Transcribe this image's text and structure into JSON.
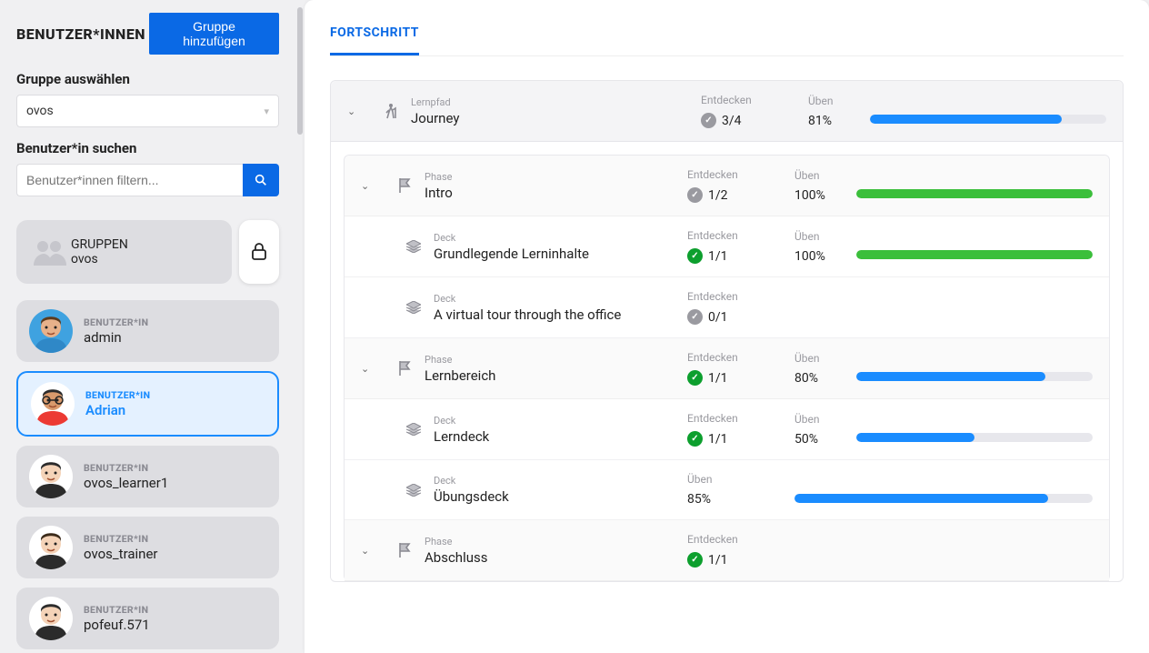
{
  "sidebar": {
    "title": "BENUTZER*INNEN",
    "add_group_btn": "Gruppe hinzufügen",
    "group_select_label": "Gruppe auswählen",
    "group_selected": "ovos",
    "search_label": "Benutzer*in suchen",
    "search_placeholder": "Benutzer*innen filtern...",
    "group_card": {
      "type": "GRUPPEN",
      "name": "ovos"
    },
    "users": [
      {
        "type": "BENUTZER*IN",
        "name": "admin",
        "bg": "#3fa2e0",
        "shirt": "#2f88c7",
        "skin": "#e7b18a",
        "hair": "#5b3a1d"
      },
      {
        "type": "BENUTZER*IN",
        "name": "Adrian",
        "bg": "#fff",
        "shirt": "#ec3a33",
        "skin": "#d99a6c",
        "hair": "#2b2b2b",
        "glasses": true
      },
      {
        "type": "BENUTZER*IN",
        "name": "ovos_learner1",
        "bg": "#fff",
        "shirt": "#2b2b2b",
        "skin": "#f4d3b8",
        "hair": "#2b2b2b"
      },
      {
        "type": "BENUTZER*IN",
        "name": "ovos_trainer",
        "bg": "#fff",
        "shirt": "#2b2b2b",
        "skin": "#f4d3b8",
        "hair": "#3b2a1a"
      },
      {
        "type": "BENUTZER*IN",
        "name": "pofeuf.571",
        "bg": "#fff",
        "shirt": "#2b2b2b",
        "skin": "#f4d3b8",
        "hair": "#2b2b2b"
      }
    ],
    "selected_index": 1
  },
  "main": {
    "tab": "FORTSCHRITT",
    "labels": {
      "lernpfad": "Lernpfad",
      "phase": "Phase",
      "deck": "Deck",
      "entdecken": "Entdecken",
      "ueben": "Üben"
    },
    "journey": {
      "title": "Journey",
      "discover": "3/4",
      "discover_state": "gray",
      "practice_pct": 81,
      "bar": "blue"
    },
    "phases": [
      {
        "title": "Intro",
        "discover": "1/2",
        "discover_state": "gray",
        "practice_pct": 100,
        "bar": "green",
        "decks": [
          {
            "title": "Grundlegende Lerninhalte",
            "discover": "1/1",
            "discover_state": "green",
            "practice_pct": 100,
            "bar": "green"
          },
          {
            "title": "A virtual tour through the office",
            "discover": "0/1",
            "discover_state": "gray",
            "no_practice": true
          }
        ]
      },
      {
        "title": "Lernbereich",
        "discover": "1/1",
        "discover_state": "green",
        "practice_pct": 80,
        "bar": "blue",
        "decks": [
          {
            "title": "Lerndeck",
            "discover": "1/1",
            "discover_state": "green",
            "practice_pct": 50,
            "bar": "blue"
          },
          {
            "title": "Übungsdeck",
            "no_discover": true,
            "practice_pct": 85,
            "bar": "blue"
          }
        ]
      },
      {
        "title": "Abschluss",
        "discover": "1/1",
        "discover_state": "green",
        "no_practice": true,
        "decks": []
      }
    ]
  }
}
